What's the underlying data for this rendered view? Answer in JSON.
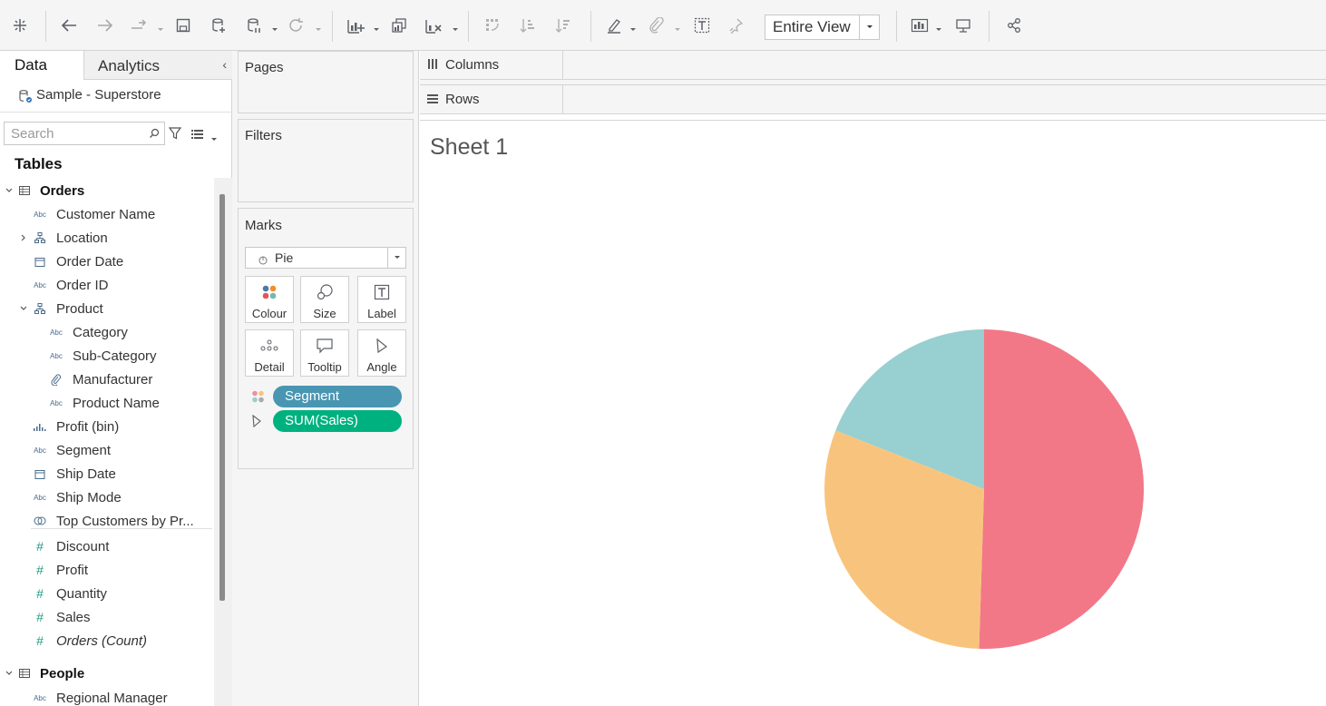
{
  "toolbar": {
    "fit": {
      "value": "Entire View"
    }
  },
  "data_pane": {
    "tabs": {
      "data": "Data",
      "analytics": "Analytics"
    },
    "datasource": "Sample - Superstore",
    "search": {
      "placeholder": "Search"
    },
    "tables_header": "Tables",
    "fields": [
      {
        "label": "Orders",
        "kind": "table",
        "icon": "table-icon"
      },
      {
        "label": "Customer Name",
        "kind": "string",
        "icon": "Abc"
      },
      {
        "label": "Location",
        "kind": "hierarchy",
        "icon": "hierarchy-icon"
      },
      {
        "label": "Order Date",
        "kind": "date",
        "icon": "calendar-icon"
      },
      {
        "label": "Order ID",
        "kind": "string",
        "icon": "Abc"
      },
      {
        "label": "Product",
        "kind": "hierarchy",
        "icon": "hierarchy-icon"
      },
      {
        "label": "Category",
        "kind": "string",
        "icon": "Abc"
      },
      {
        "label": "Sub-Category",
        "kind": "string",
        "icon": "Abc"
      },
      {
        "label": "Manufacturer",
        "kind": "group",
        "icon": "paperclip-icon"
      },
      {
        "label": "Product Name",
        "kind": "string",
        "icon": "Abc"
      },
      {
        "label": "Profit (bin)",
        "kind": "bin",
        "icon": "bin-icon"
      },
      {
        "label": "Segment",
        "kind": "string",
        "icon": "Abc"
      },
      {
        "label": "Ship Date",
        "kind": "date",
        "icon": "calendar-icon"
      },
      {
        "label": "Ship Mode",
        "kind": "string",
        "icon": "Abc"
      },
      {
        "label": "Top Customers by Pr...",
        "kind": "set",
        "icon": "set-icon"
      },
      {
        "label": "Discount",
        "kind": "measure",
        "icon": "#"
      },
      {
        "label": "Profit",
        "kind": "measure",
        "icon": "#"
      },
      {
        "label": "Quantity",
        "kind": "measure",
        "icon": "#"
      },
      {
        "label": "Sales",
        "kind": "measure",
        "icon": "#"
      },
      {
        "label": "Orders (Count)",
        "kind": "measure",
        "icon": "#"
      },
      {
        "label": "People",
        "kind": "table",
        "icon": "table-icon"
      },
      {
        "label": "Regional Manager",
        "kind": "string",
        "icon": "Abc"
      }
    ]
  },
  "shelves": {
    "pages": "Pages",
    "filters": "Filters",
    "marks": {
      "title": "Marks",
      "type": "Pie",
      "buttons": [
        "Colour",
        "Size",
        "Label",
        "Detail",
        "Tooltip",
        "Angle"
      ],
      "pills": [
        {
          "label": "Segment",
          "encoding": "colour",
          "color": "#4996b2"
        },
        {
          "label": "SUM(Sales)",
          "encoding": "angle",
          "color": "#00b180"
        }
      ]
    },
    "columns": "Columns",
    "rows": "Rows"
  },
  "view": {
    "sheet_title": "Sheet 1"
  },
  "chart_data": {
    "type": "pie",
    "title": "Sheet 1",
    "measure": "SUM(Sales)",
    "color_dimension": "Segment",
    "slices": [
      {
        "share": 0.505,
        "color": "#f27887"
      },
      {
        "share": 0.305,
        "color": "#f8c47d"
      },
      {
        "share": 0.19,
        "color": "#98cfd0"
      }
    ]
  }
}
